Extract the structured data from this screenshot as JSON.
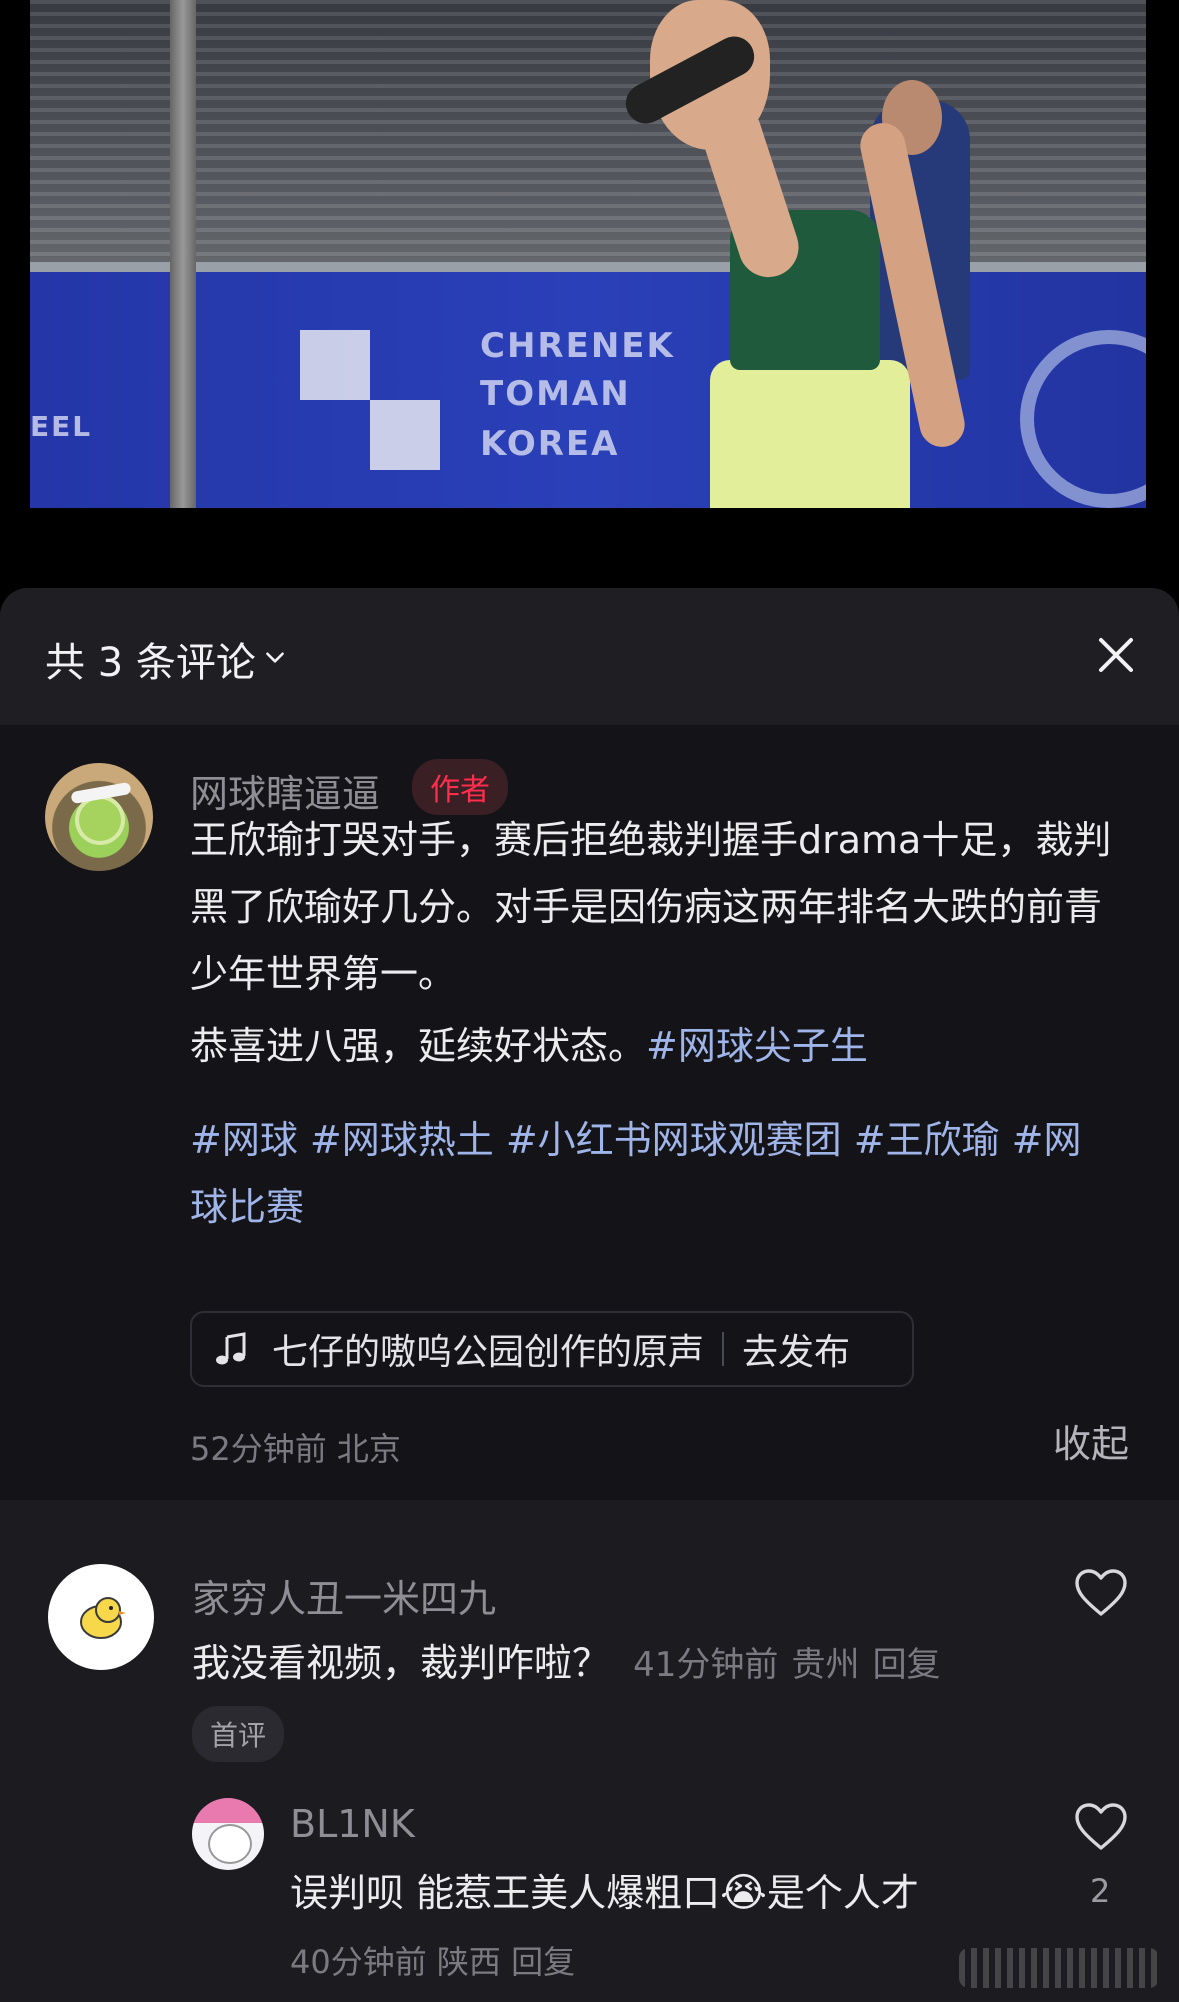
{
  "header": {
    "title": "共 3 条评论"
  },
  "author_comment": {
    "username": "网球瞎逼逼",
    "tag": "作者",
    "paragraph1": "王欣瑜打哭对手，赛后拒绝裁判握手drama十足，裁判黑了欣瑜好几分。对手是因伤病这两年排名大跌的前青少年世界第一。",
    "paragraph2_text": "恭喜进八强，延续好状态。",
    "paragraph2_hashtag": "#网球尖子生",
    "hashtags_line1": "#网球 #网球热土 #小红书网球观赛团 #王欣瑜 #网",
    "hashtags_line2": "球比赛",
    "music_title": "七仔的嗷呜公园创作的原声",
    "music_action": "去发布",
    "time": "52分钟前",
    "location": "北京",
    "collapse_label": "收起"
  },
  "comments": [
    {
      "username": "家穷人丑一米四九",
      "text": "我没看视频，裁判咋啦？",
      "time": "41分钟前",
      "location": "贵州",
      "reply_label": "回复",
      "badge": "首评"
    }
  ],
  "replies": [
    {
      "username": "BL1NK",
      "text_before": "误判呗 能惹王美人爆粗口",
      "text_after": "是个人才",
      "emoji": "😭",
      "time": "40分钟前",
      "location": "陕西",
      "reply_label": "回复",
      "like_count": "2"
    }
  ],
  "video": {
    "banner_text_1": "CHRENEK",
    "banner_text_2": "TOMAN",
    "banner_text_3": "KOREA",
    "banner_text_left": "EEL"
  },
  "colors": {
    "sheet_bg": "#1c1c20",
    "author_bg": "#141418",
    "hashtag": "#9fb4e8",
    "author_tag": "#ff2e4d"
  }
}
